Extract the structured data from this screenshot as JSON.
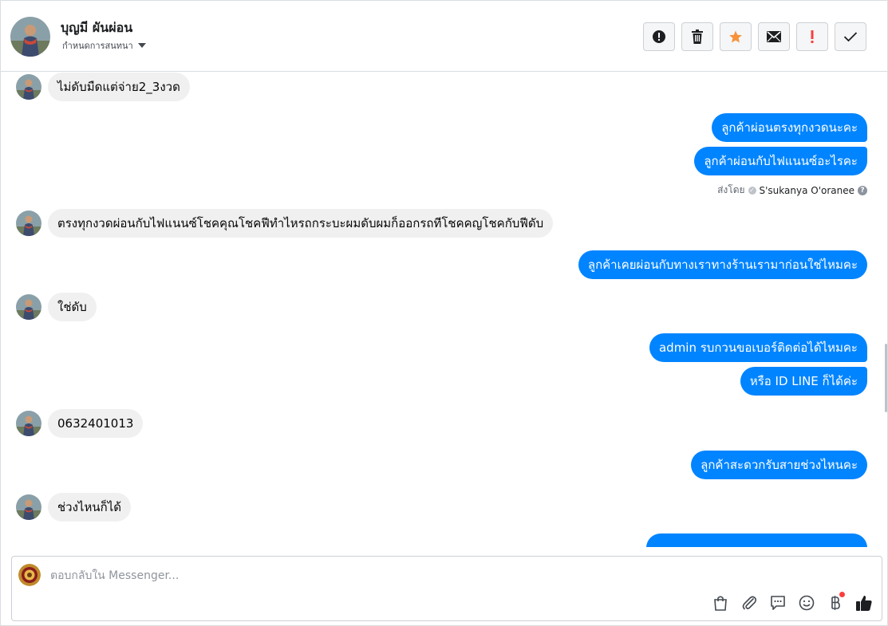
{
  "contact": {
    "name": "บุญมี ผันผ่อน",
    "label_button": "กำหนดการสนทนา"
  },
  "toolbar": {
    "icons": [
      "spam-icon",
      "trash-icon",
      "star-icon",
      "envelope-icon",
      "important-icon",
      "done-icon"
    ],
    "star_color": "#f7923b",
    "important_color": "#fa3e3e"
  },
  "messages": {
    "m1": "ไม่ดับมืดแต่จ่าย2_3งวด",
    "m2": "ลูกค้าผ่อนตรงทุกงวดนะคะ",
    "m3": "ลูกค้าผ่อนกับไฟแนนซ์อะไรคะ",
    "sent_by_label": "ส่งโดย",
    "sent_by_agent": "S'sukanya O'oranee",
    "m4": "ตรงทุกงวดผ่อนกับไฟแนนซ์โชคคุณโชคฟีทำไหรถกระบะผมดับผมก็ออกรถทีโชคคญโชคกับฟีดับ",
    "m5": "ลูกค้าเคยผ่อนกับทางเราทางร้านเรามาก่อนใช่ไหมคะ",
    "m6": "ใช่ดับ",
    "m7": "admin รบกวนขอเบอร์ติดต่อได้ไหมคะ",
    "m8": "หรือ ID LINE ก็ได้ค่ะ",
    "m9": "0632401013",
    "m10": "ลูกค้าสะดวกรับสายช่วงไหนคะ",
    "m11": "ช่วงไหนก็ได้"
  },
  "composer": {
    "placeholder": "ตอบกลับใน Messenger...",
    "tools": [
      "shopping-bag-icon",
      "paperclip-icon",
      "saved-replies-icon",
      "emoji-icon",
      "baht-payment-icon",
      "thumbs-up-icon"
    ]
  },
  "colors": {
    "outgoing_bubble": "#0084ff",
    "incoming_bubble": "#f0f0f0"
  }
}
